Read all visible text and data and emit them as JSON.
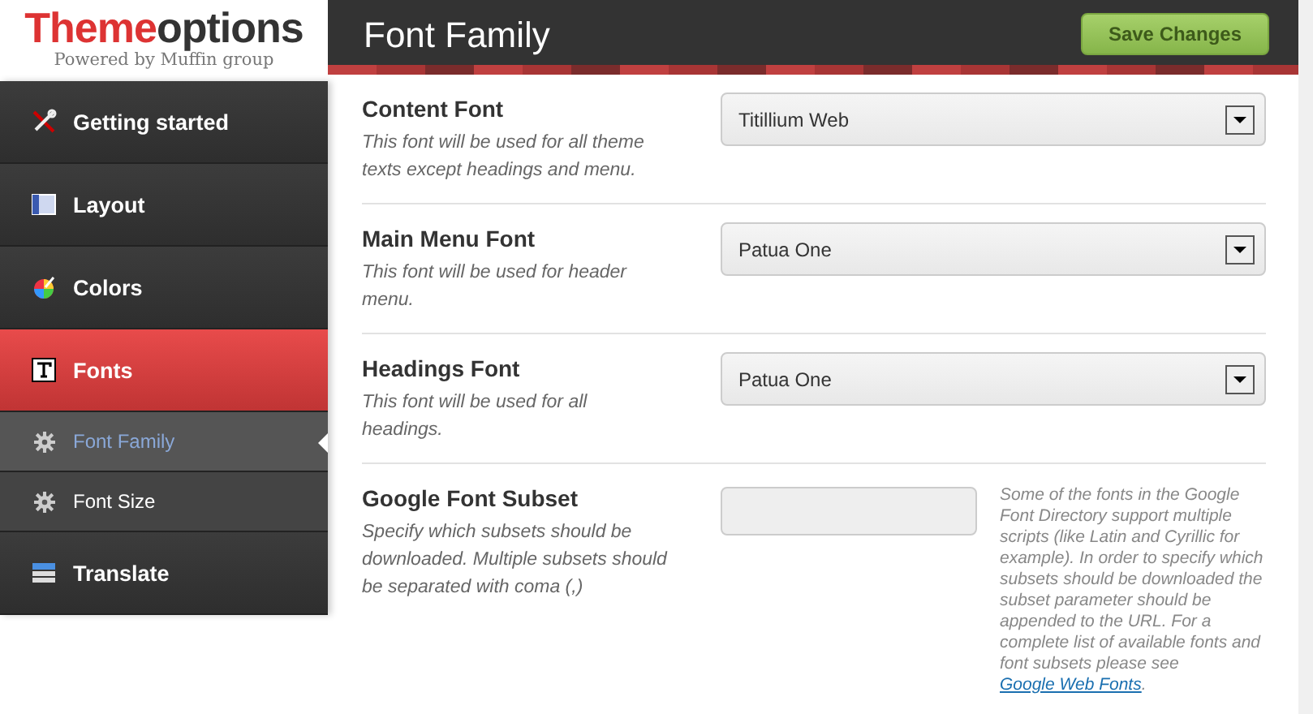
{
  "logo": {
    "accent": "Theme",
    "rest": "options",
    "tagline": "Powered by Muffin group"
  },
  "menu": [
    {
      "label": "Getting started",
      "kind": "main",
      "selected": false
    },
    {
      "label": "Layout",
      "kind": "main",
      "selected": false
    },
    {
      "label": "Colors",
      "kind": "main",
      "selected": false
    },
    {
      "label": "Fonts",
      "kind": "main",
      "selected": true
    },
    {
      "label": "Font Family",
      "kind": "sub",
      "selected": true
    },
    {
      "label": "Font Size",
      "kind": "sub",
      "selected": false
    },
    {
      "label": "Translate",
      "kind": "main",
      "selected": false
    }
  ],
  "page_title": "Font Family",
  "save_button": "Save Changes",
  "options": [
    {
      "kind": "select",
      "title": "Content Font",
      "description": "This font will be used for all theme texts except headings and menu.",
      "value": "Titillium Web"
    },
    {
      "kind": "select",
      "title": "Main Menu Font",
      "description": "This font will be used for header menu.",
      "value": "Patua One"
    },
    {
      "kind": "select",
      "title": "Headings Font",
      "description": "This font will be used for all headings.",
      "value": "Patua One"
    },
    {
      "kind": "text",
      "title": "Google Font Subset",
      "description": "Specify which subsets should be downloaded. Multiple subsets should be separated with coma (,)",
      "help": "Some of the fonts in the Google Font Directory support multiple scripts (like Latin and Cyrillic for example). In order to specify which subsets should be downloaded the subset parameter should be appended to the URL. For a complete list of available fonts and font subsets please see",
      "link": "Google Web Fonts",
      "help_end": "."
    }
  ]
}
